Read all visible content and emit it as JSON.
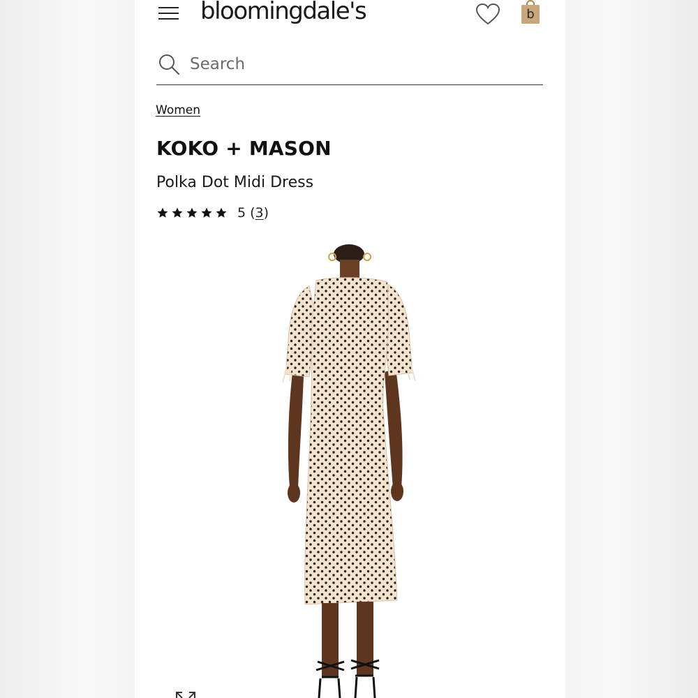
{
  "header": {
    "logo_text": "bloomingdale's",
    "bag_letter": "b",
    "bag_color": "#c8a77a"
  },
  "search": {
    "placeholder": "Search"
  },
  "breadcrumb": {
    "label": "Women"
  },
  "product": {
    "brand": "KOKO + MASON",
    "name": "Polka Dot Midi Dress",
    "rating_value": "5",
    "rating_open": "(",
    "rating_count": "3",
    "rating_close": ")",
    "stars": 5
  },
  "icons": {
    "menu": "hamburger-icon",
    "wishlist": "heart-icon",
    "bag": "shopping-bag-icon",
    "search": "search-icon",
    "expand": "expand-icon",
    "star": "star-icon"
  }
}
